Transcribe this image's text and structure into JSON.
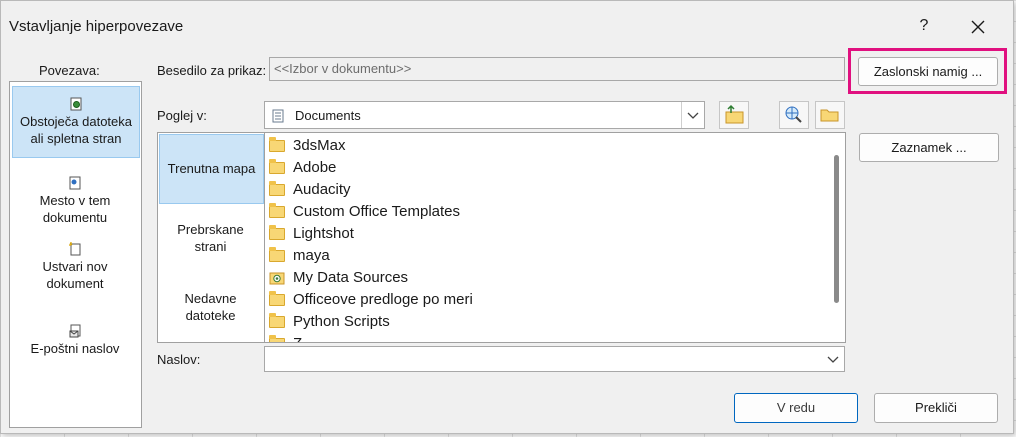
{
  "dialog": {
    "title": "Vstavljanje hiperpovezave",
    "help": "?"
  },
  "link_to": {
    "label": "Povezava:",
    "items": [
      {
        "line1": "Obstoječa datoteka",
        "line2": "ali spletna stran",
        "selected": true
      },
      {
        "line1": "Mesto v tem",
        "line2": "dokumentu",
        "selected": false
      },
      {
        "line1": "Ustvari nov",
        "line2": "dokument",
        "selected": false
      },
      {
        "line1": "E-poštni naslov",
        "line2": "",
        "selected": false
      }
    ]
  },
  "text_to_display": {
    "label": "Besedilo za prikaz:",
    "value": "<<Izbor v dokumentu>>"
  },
  "look_in": {
    "label": "Poglej v:",
    "value": "Documents"
  },
  "places": [
    {
      "line1": "Trenutna mapa",
      "line2": "",
      "selected": true
    },
    {
      "line1": "Prebrskane",
      "line2": "strani",
      "selected": false
    },
    {
      "line1": "Nedavne",
      "line2": "datoteke",
      "selected": false
    }
  ],
  "files": [
    {
      "name": "3dsMax",
      "type": "folder"
    },
    {
      "name": "Adobe",
      "type": "folder"
    },
    {
      "name": "Audacity",
      "type": "folder"
    },
    {
      "name": "Custom Office Templates",
      "type": "folder"
    },
    {
      "name": "Lightshot",
      "type": "folder"
    },
    {
      "name": "maya",
      "type": "folder"
    },
    {
      "name": "My Data Sources",
      "type": "datasource"
    },
    {
      "name": "Officeove predloge po meri",
      "type": "folder"
    },
    {
      "name": "Python Scripts",
      "type": "folder"
    },
    {
      "name": "Z...",
      "type": "folder"
    }
  ],
  "address": {
    "label": "Naslov:",
    "value": ""
  },
  "buttons": {
    "screentip": "Zaslonski namig ...",
    "bookmark": "Zaznamek ...",
    "ok": "V redu",
    "cancel": "Prekliči"
  },
  "colors": {
    "highlight": "#e0107f",
    "selection": "#cce4f7"
  }
}
